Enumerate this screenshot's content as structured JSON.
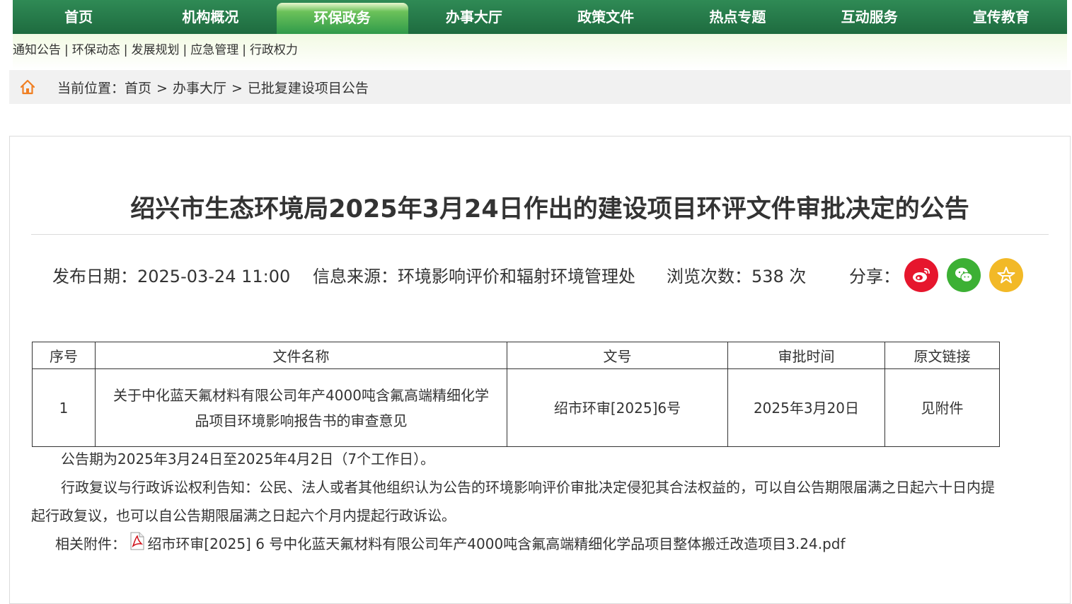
{
  "nav": {
    "items": [
      {
        "label": "首页"
      },
      {
        "label": "机构概况"
      },
      {
        "label": "环保政务"
      },
      {
        "label": "办事大厅"
      },
      {
        "label": "政策文件"
      },
      {
        "label": "热点专题"
      },
      {
        "label": "互动服务"
      },
      {
        "label": "宣传教育"
      }
    ],
    "active_index": 2
  },
  "subnav": {
    "links": [
      "通知公告",
      "环保动态",
      "发展规划",
      "应急管理",
      "行政权力"
    ],
    "separator": "|"
  },
  "breadcrumb": {
    "prefix": "当前位置：",
    "items": [
      "首页",
      "办事大厅",
      "已批复建设项目公告"
    ],
    "separator": ">"
  },
  "article": {
    "title": "绍兴市生态环境局2025年3月24日作出的建设项目环评文件审批决定的公告",
    "meta": {
      "publish_date": "发布日期：2025-03-24 11:00",
      "source": "信息来源：环境影响评价和辐射环境管理处",
      "views": "浏览次数：538 次",
      "share_label": "分享："
    },
    "share_icons": [
      {
        "name": "weibo-icon",
        "color": "#e6162d"
      },
      {
        "name": "wechat-icon",
        "color": "#3cb034"
      },
      {
        "name": "favorite-star-icon",
        "color": "#f2b927"
      }
    ],
    "table": {
      "headers": [
        "序号",
        "文件名称",
        "文号",
        "审批时间",
        "原文链接"
      ],
      "rows": [
        {
          "index": "1",
          "name_line1": "关于中化蓝天氟材料有限公司年产4000吨含氟高端精细化学",
          "name_line2": "品项目环境影响报告书的审查意见",
          "doc_no": "绍市环审[2025]6号",
          "approval_date": "2025年3月20日",
          "link": "见附件"
        }
      ]
    },
    "notice_period": "公告期为2025年3月24日至2025年4月2日（7个工作日）。",
    "rights_line1": "行政复议与行政诉讼权利告知：公民、法人或者其他组织认为公告的环境影响评价审批决定侵犯其合法权益的，可以自公告期限届满之日起六十日内提",
    "rights_line2": "起行政复议，也可以自公告期限届满之日起六个月内提起行政诉讼。",
    "attachment_label": "相关附件：",
    "attachment_file": "绍市环审[2025] 6 号中化蓝天氟材料有限公司年产4000吨含氟高端精细化学品项目整体搬迁改造项目3.24.pdf"
  }
}
